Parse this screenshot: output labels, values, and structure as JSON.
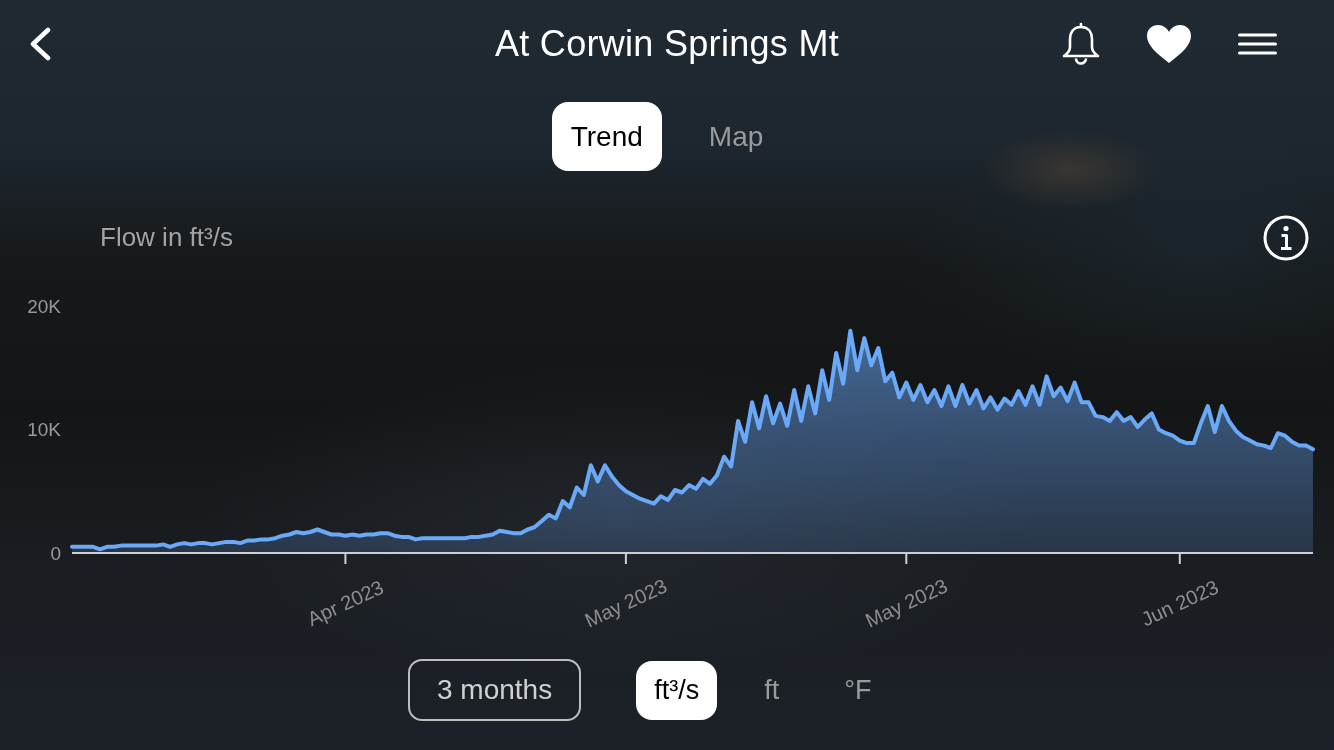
{
  "header": {
    "title": "At Corwin Springs Mt"
  },
  "tabs": [
    {
      "label": "Trend",
      "selected": true
    },
    {
      "label": "Map",
      "selected": false
    }
  ],
  "trend": {
    "chart_data": {
      "type": "area",
      "ylabel": "Flow in ft³/s",
      "color": "#6aa8f8",
      "ylim": [
        0,
        20000
      ],
      "yticks": [
        {
          "value": 0,
          "label": "0"
        },
        {
          "value": 10000,
          "label": "10K"
        },
        {
          "value": 20000,
          "label": "20K"
        }
      ],
      "categories": [
        null,
        null,
        null,
        null,
        null,
        null,
        null,
        null,
        null,
        null,
        null,
        null,
        null,
        null,
        null,
        null,
        null,
        null,
        null,
        null,
        null,
        null,
        null,
        null,
        null,
        null,
        null,
        null,
        null,
        null,
        null,
        null,
        null,
        null,
        null,
        null,
        null,
        null,
        null,
        "Apr 2023",
        null,
        null,
        null,
        null,
        null,
        null,
        null,
        null,
        null,
        null,
        null,
        null,
        null,
        null,
        null,
        null,
        null,
        null,
        null,
        null,
        null,
        null,
        null,
        null,
        null,
        null,
        null,
        null,
        null,
        null,
        null,
        null,
        null,
        null,
        null,
        null,
        null,
        null,
        null,
        "May 2023",
        null,
        null,
        null,
        null,
        null,
        null,
        null,
        null,
        null,
        null,
        null,
        null,
        null,
        null,
        null,
        null,
        null,
        null,
        null,
        null,
        null,
        null,
        null,
        null,
        null,
        null,
        null,
        null,
        null,
        null,
        null,
        null,
        null,
        null,
        null,
        null,
        null,
        null,
        null,
        "May 2023",
        null,
        null,
        null,
        null,
        null,
        null,
        null,
        null,
        null,
        null,
        null,
        null,
        null,
        null,
        null,
        null,
        null,
        null,
        null,
        null,
        null,
        null,
        null,
        null,
        null,
        null,
        null,
        null,
        null,
        null,
        null,
        null,
        null,
        null,
        null,
        null,
        null,
        null,
        "Jun 2023",
        null,
        null,
        null,
        null,
        null,
        null,
        null,
        null,
        null,
        null,
        null,
        null,
        null,
        null,
        null,
        null,
        null,
        null,
        null
      ],
      "values": [
        500,
        500,
        500,
        500,
        300,
        500,
        500,
        600,
        600,
        600,
        600,
        600,
        600,
        700,
        500,
        700,
        800,
        700,
        800,
        800,
        700,
        800,
        900,
        900,
        800,
        1000,
        1000,
        1100,
        1100,
        1200,
        1400,
        1500,
        1700,
        1600,
        1700,
        1900,
        1700,
        1500,
        1500,
        1400,
        1500,
        1400,
        1500,
        1500,
        1600,
        1600,
        1400,
        1300,
        1300,
        1100,
        1200,
        1200,
        1200,
        1200,
        1200,
        1200,
        1200,
        1300,
        1300,
        1400,
        1500,
        1800,
        1700,
        1600,
        1600,
        1900,
        2100,
        2600,
        3100,
        2800,
        4200,
        3700,
        5300,
        4700,
        7100,
        5800,
        7100,
        6200,
        5500,
        5000,
        4700,
        4400,
        4200,
        4000,
        4600,
        4300,
        5100,
        4900,
        5500,
        5200,
        6000,
        5600,
        6300,
        7800,
        7000,
        10700,
        9000,
        12200,
        10100,
        12700,
        10500,
        12100,
        10300,
        13200,
        10700,
        13500,
        11300,
        14800,
        12400,
        16200,
        13700,
        18000,
        14800,
        17400,
        15200,
        16600,
        13900,
        14600,
        12600,
        13800,
        12400,
        13600,
        12200,
        13200,
        11900,
        13500,
        11900,
        13600,
        12100,
        13200,
        11700,
        12600,
        11600,
        12500,
        12000,
        13100,
        12000,
        13500,
        12000,
        14300,
        12700,
        13400,
        12300,
        13800,
        12200,
        12200,
        11100,
        11000,
        10700,
        11400,
        10700,
        11000,
        10200,
        10800,
        11300,
        10000,
        9700,
        9500,
        9100,
        8900,
        8900,
        10500,
        11900,
        9800,
        11900,
        10700,
        9900,
        9400,
        9100,
        8800,
        8700,
        8500,
        9700,
        9500,
        9000,
        8700,
        8700,
        8400
      ]
    }
  },
  "range_button": {
    "label": "3 months"
  },
  "units": [
    {
      "label": "ft³/s",
      "selected": true
    },
    {
      "label": "ft",
      "selected": false
    },
    {
      "label": "°F",
      "selected": false
    }
  ]
}
